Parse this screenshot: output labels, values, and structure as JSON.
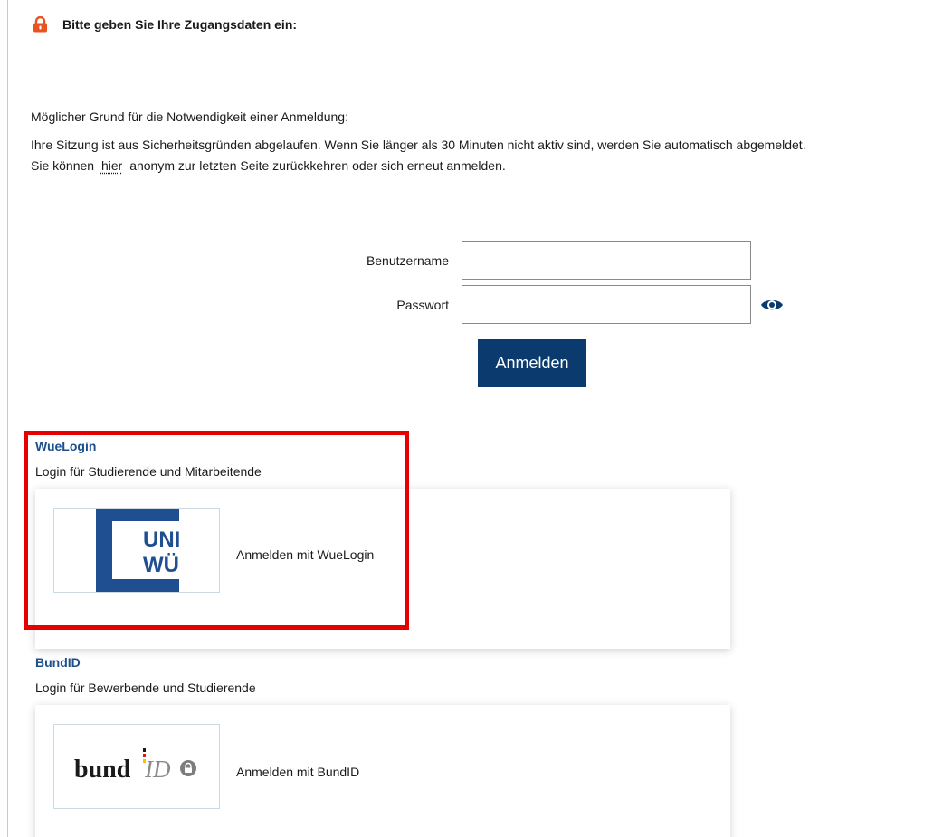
{
  "notice": {
    "icon": "lock-icon",
    "text": "Bitte geben Sie Ihre Zugangsdaten ein:"
  },
  "reason": {
    "heading": "Möglicher Grund für die Notwendigkeit einer Anmeldung:",
    "line1": "Ihre Sitzung ist aus Sicherheitsgründen abgelaufen. Wenn Sie länger als 30 Minuten nicht aktiv sind, werden Sie automatisch abgemeldet.",
    "line2_before": "Sie können",
    "link": "hier",
    "line2_after": "anonym zur letzten Seite zurückkehren oder sich erneut anmelden."
  },
  "form": {
    "username_label": "Benutzername",
    "username_value": "",
    "password_label": "Passwort",
    "password_value": "",
    "login_button": "Anmelden"
  },
  "providers": [
    {
      "title": "WueLogin",
      "subtitle": "Login für Studierende und Mitarbeitende",
      "logo_text_1": "UNI",
      "logo_text_2": "WÜ",
      "action": "Anmelden mit WueLogin"
    },
    {
      "title": "BundID",
      "subtitle": "Login für Bewerbende und Studierende",
      "logo_text_1": "bund",
      "logo_text_2": "ID",
      "action": "Anmelden mit BundID"
    }
  ],
  "colors": {
    "primary_button": "#0b3a6e",
    "link_title": "#1d4f8a",
    "uni_blue": "#1f4e91",
    "lock_orange": "#e8531f",
    "highlight": "#e60000"
  }
}
